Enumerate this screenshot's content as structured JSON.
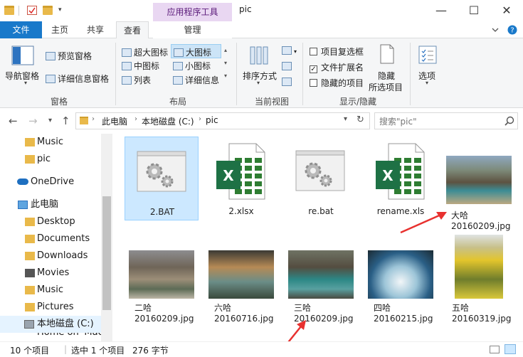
{
  "window": {
    "title": "pic",
    "context_tab_title": "应用程序工具",
    "min_symbol": "—",
    "max_symbol": "☐",
    "close_symbol": "✕"
  },
  "tabs": [
    "文件",
    "主页",
    "共享",
    "查看",
    "管理"
  ],
  "ribbon": {
    "panes": {
      "nav_pane": "导航窗格",
      "preview": "预览窗格",
      "details": "详细信息窗格",
      "group": "窗格"
    },
    "layout": {
      "items": [
        "超大图标",
        "大图标",
        "中图标",
        "小图标",
        "列表",
        "详细信息"
      ],
      "selected": "大图标",
      "group": "布局"
    },
    "current_view": {
      "sort": "排序方式",
      "group": "当前视图"
    },
    "show_hide": {
      "item_checkbox": "项目复选框",
      "file_ext": "文件扩展名",
      "hidden_items": "隐藏的项目",
      "hide_selected_line1": "隐藏",
      "hide_selected_line2": "所选项目",
      "group": "显示/隐藏"
    },
    "options": "选项"
  },
  "address": {
    "crumbs": [
      "此电脑",
      "本地磁盘 (C:)",
      "pic"
    ],
    "search_placeholder": "搜索\"pic\""
  },
  "sidebar": {
    "items": [
      "Music",
      "pic",
      "OneDrive",
      "此电脑",
      "Desktop",
      "Documents",
      "Downloads",
      "Movies",
      "Music",
      "Pictures",
      "本地磁盘 (C:)",
      "Home on 'Mac'"
    ]
  },
  "files": [
    {
      "name": "2.BAT",
      "type": "bat"
    },
    {
      "name": "2.xlsx",
      "type": "xlsx"
    },
    {
      "name": "re.bat",
      "type": "bat"
    },
    {
      "name": "rename.xls",
      "type": "xls"
    },
    {
      "name_line1": "大哈",
      "name_line2": "20160209.jpg",
      "type": "jpg"
    },
    {
      "name_line1": "二哈",
      "name_line2": "20160209.jpg",
      "type": "jpg"
    },
    {
      "name_line1": "六哈",
      "name_line2": "20160716.jpg",
      "type": "jpg"
    },
    {
      "name_line1": "三哈",
      "name_line2": "20160209.jpg",
      "type": "jpg"
    },
    {
      "name_line1": "四哈",
      "name_line2": "20160215.jpg",
      "type": "jpg"
    },
    {
      "name_line1": "五哈",
      "name_line2": "20160319.jpg",
      "type": "jpg"
    }
  ],
  "status": {
    "count": "10 个项目",
    "selected": "选中 1 个项目",
    "size": "276 字节"
  },
  "colors": {
    "accent": "#1979ca",
    "selection": "#cce8ff",
    "arrow": "#e8312f",
    "context_tab": "#e9d7f2"
  }
}
